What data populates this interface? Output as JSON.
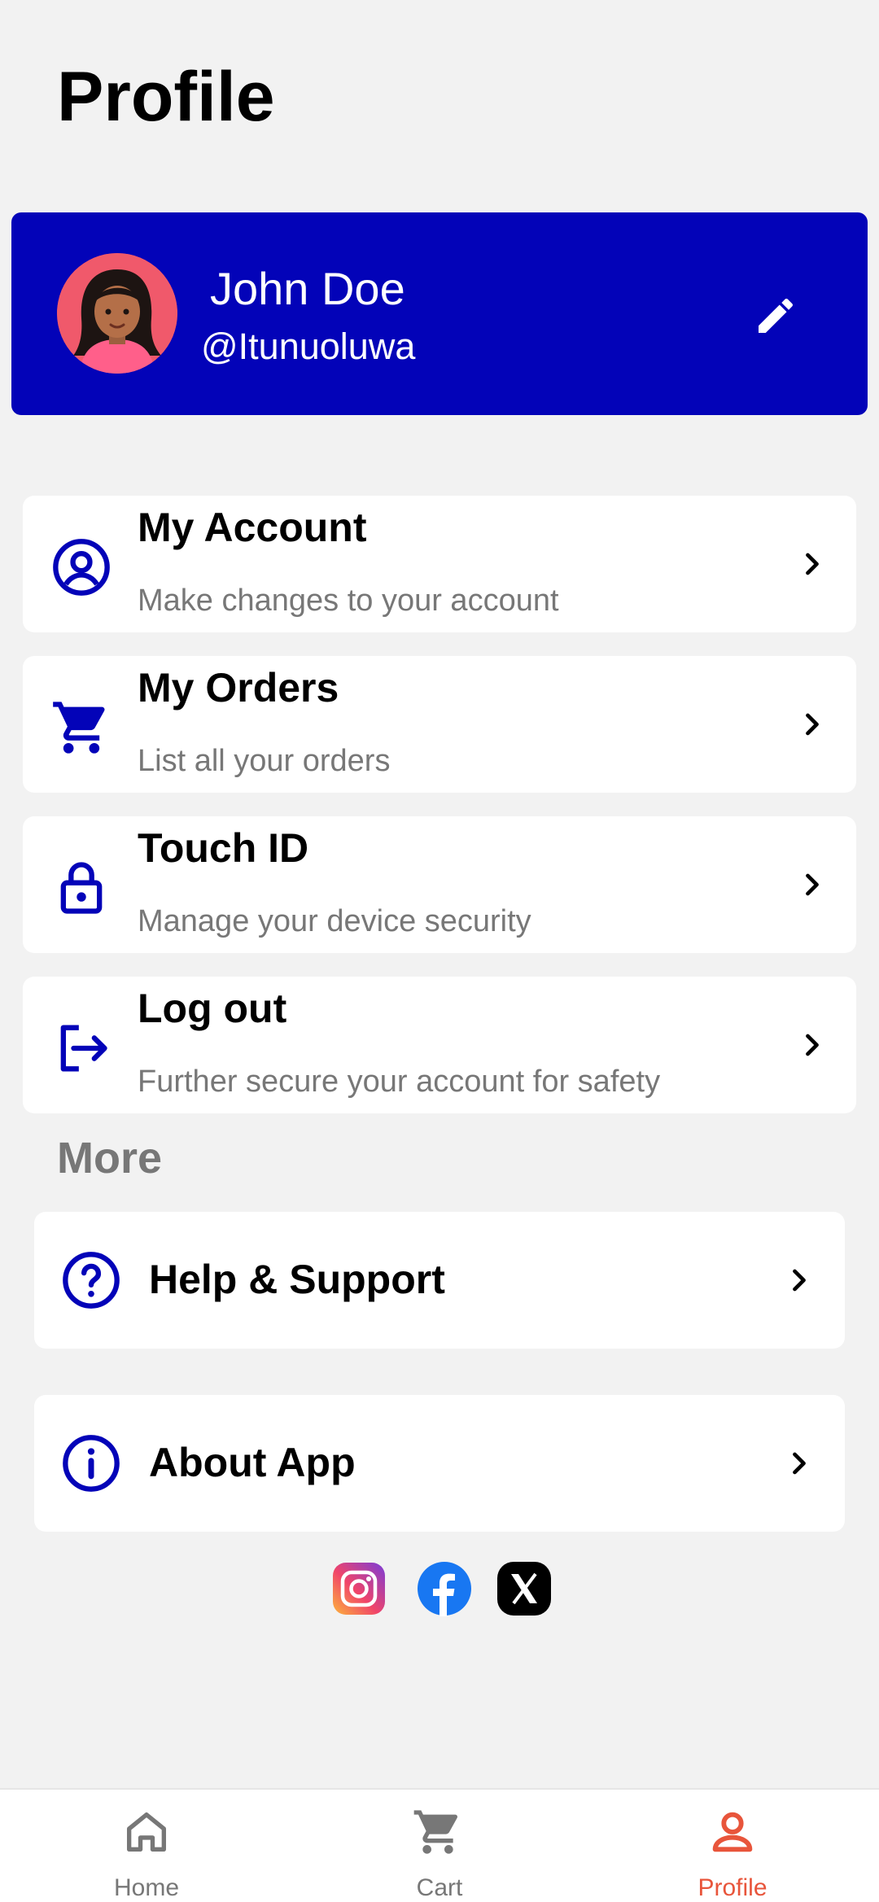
{
  "page": {
    "title": "Profile"
  },
  "profile": {
    "name": "John Doe",
    "handle": "@Itunuoluwa",
    "card_color": "#0303b8",
    "avatar_icon": "avatar-image",
    "edit_icon": "pencil-icon"
  },
  "menu": [
    {
      "title": "My Account",
      "subtitle": "Make changes to your account",
      "icon": "user-circle-icon"
    },
    {
      "title": "My Orders",
      "subtitle": "List all your orders",
      "icon": "cart-icon"
    },
    {
      "title": "Touch ID",
      "subtitle": "Manage your device security",
      "icon": "lock-icon"
    },
    {
      "title": "Log out",
      "subtitle": "Further secure your account for safety",
      "icon": "logout-icon"
    }
  ],
  "more": {
    "heading": "More",
    "items": [
      {
        "title": "Help & Support",
        "icon": "help-circle-icon"
      },
      {
        "title": "About App",
        "icon": "info-circle-icon"
      }
    ]
  },
  "social": [
    "instagram-icon",
    "facebook-icon",
    "x-icon"
  ],
  "nav": {
    "items": [
      {
        "label": "Home",
        "icon": "home-icon",
        "active": false
      },
      {
        "label": "Cart",
        "icon": "cart-icon",
        "active": false
      },
      {
        "label": "Profile",
        "icon": "person-icon",
        "active": true
      }
    ],
    "active_color": "#e8553b",
    "inactive_color": "#777777"
  },
  "colors": {
    "accent": "#0303b8",
    "background": "#f2f2f2"
  }
}
